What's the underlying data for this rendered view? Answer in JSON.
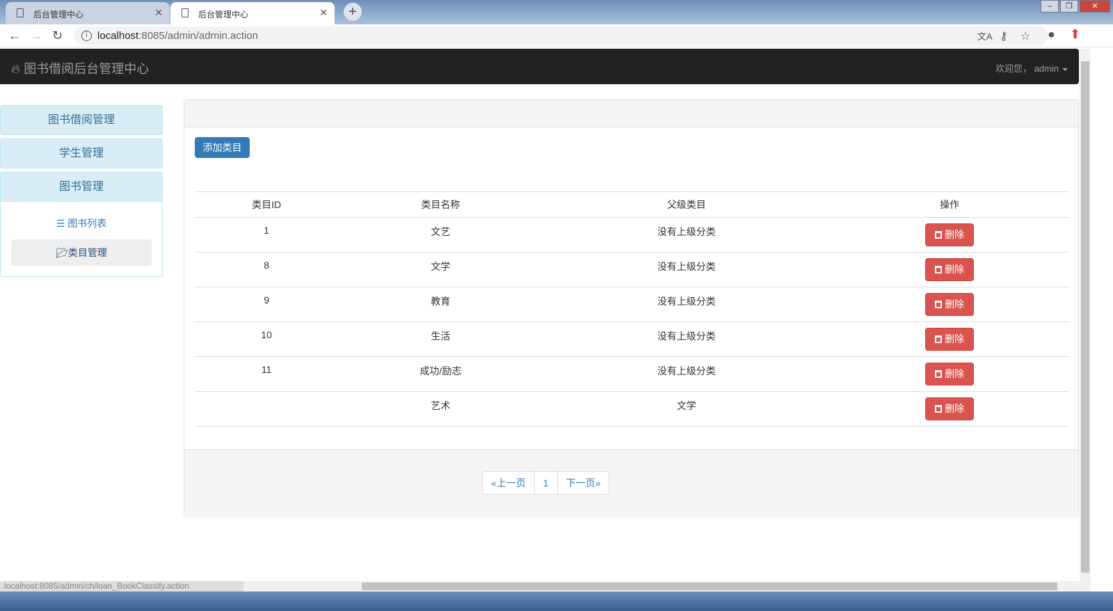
{
  "browser": {
    "tabs": [
      {
        "title": "后台管理中心",
        "active": false
      },
      {
        "title": "后台管理中心",
        "active": true
      }
    ],
    "url_host": "localhost",
    "url_rest": ":8085/admin/admin.action",
    "status_url": "localhost:8085/admin/ch/loan_BookClassify.action"
  },
  "navbar": {
    "brand": "图书借阅后台管理中心",
    "user": "欢迎您， admin"
  },
  "sidebar": {
    "panels": [
      "图书借阅管理",
      "学生管理",
      "图书管理"
    ],
    "items": [
      {
        "label": "图书列表",
        "icon": "list-icon"
      },
      {
        "label": "类目管理",
        "icon": "folder-open-icon",
        "active": true
      }
    ]
  },
  "main": {
    "add_button": "添加类目",
    "columns": [
      "类目ID",
      "类目名称",
      "父级类目",
      "操作"
    ],
    "rows": [
      {
        "id": "1",
        "name": "文艺",
        "parent": "没有上级分类"
      },
      {
        "id": "8",
        "name": "文学",
        "parent": "没有上级分类"
      },
      {
        "id": "9",
        "name": "教育",
        "parent": "没有上级分类"
      },
      {
        "id": "10",
        "name": "生活",
        "parent": "没有上级分类"
      },
      {
        "id": "11",
        "name": "成功/励志",
        "parent": "没有上级分类"
      },
      {
        "id": "",
        "name": "艺术",
        "parent": "文学"
      }
    ],
    "delete_label": "删除",
    "pagination": {
      "prev": "«上一页",
      "current": "1",
      "next": "下一页»"
    }
  },
  "colors": {
    "navbar": "#222222",
    "primary": "#337ab7",
    "danger": "#d9534f",
    "panel_info": "#d9edf7"
  }
}
